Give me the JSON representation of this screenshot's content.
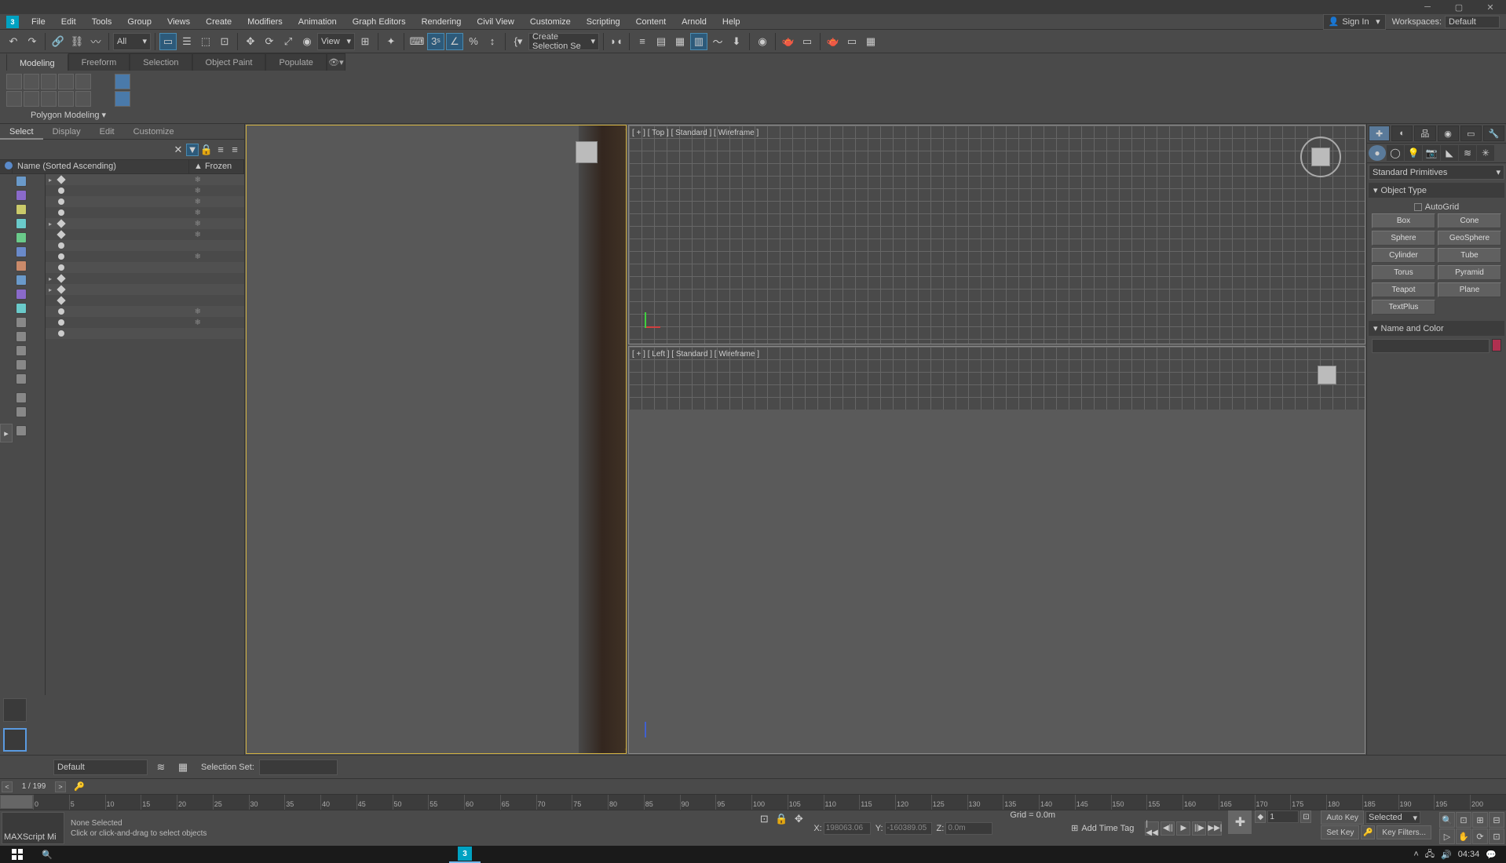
{
  "title": "",
  "menu": [
    "File",
    "Edit",
    "Tools",
    "Group",
    "Views",
    "Create",
    "Modifiers",
    "Animation",
    "Graph Editors",
    "Rendering",
    "Civil View",
    "Customize",
    "Scripting",
    "Content",
    "Arnold",
    "Help"
  ],
  "signin": "Sign In",
  "workspace_label": "Workspaces:",
  "workspace_value": "Default",
  "toolbar_all": "All",
  "toolbar_view": "View",
  "toolbar_selset": "Create Selection Se",
  "ribbon_tabs": [
    "Modeling",
    "Freeform",
    "Selection",
    "Object Paint",
    "Populate"
  ],
  "ribbon_polygroup": "Polygon Modeling",
  "leftpanel": {
    "tabs": [
      "Select",
      "Display",
      "Edit",
      "Customize"
    ],
    "header_name": "Name (Sorted Ascending)",
    "header_frozen": "▲ Frozen"
  },
  "viewports": {
    "top": "[ + ] [ Top ] [ Standard ] [ Wireframe ]",
    "left": "[ + ] [ Left ] [ Standard ] [ Wireframe ]",
    "persp": ""
  },
  "rightpanel": {
    "dropdown": "Standard Primitives",
    "roll_objtype": "Object Type",
    "autogrid": "AutoGrid",
    "buttons": [
      "Box",
      "Cone",
      "Sphere",
      "GeoSphere",
      "Cylinder",
      "Tube",
      "Torus",
      "Pyramid",
      "Teapot",
      "Plane",
      "TextPlus"
    ],
    "roll_namecolor": "Name and Color"
  },
  "bottombar": {
    "default": "Default",
    "selset_label": "Selection Set:"
  },
  "timeline": {
    "frame": "1 / 199",
    "ticks": [
      "0",
      "5",
      "10",
      "15",
      "20",
      "25",
      "30",
      "35",
      "40",
      "45",
      "50",
      "55",
      "60",
      "65",
      "70",
      "75",
      "80",
      "85",
      "90",
      "95",
      "100",
      "105",
      "110",
      "115",
      "120",
      "125",
      "130",
      "135",
      "140",
      "145",
      "150",
      "155",
      "160",
      "165",
      "170",
      "175",
      "180",
      "185",
      "190",
      "195",
      "200"
    ]
  },
  "status": {
    "maxscript": "MAXScript Mi",
    "line1": "None Selected",
    "line2": "Click or click-and-drag to select objects",
    "x_label": "X:",
    "y_label": "Y:",
    "z_label": "Z:",
    "x_val": "198063.06",
    "y_val": "-160389.05",
    "z_val": "0.0m",
    "grid": "Grid = 0.0m",
    "addtime": "Add Time Tag",
    "frame_input": "1",
    "autokey": "Auto Key",
    "setkey": "Set Key",
    "selected": "Selected",
    "keyfilters": "Key Filters..."
  },
  "taskbar": {
    "time": "04:34"
  }
}
